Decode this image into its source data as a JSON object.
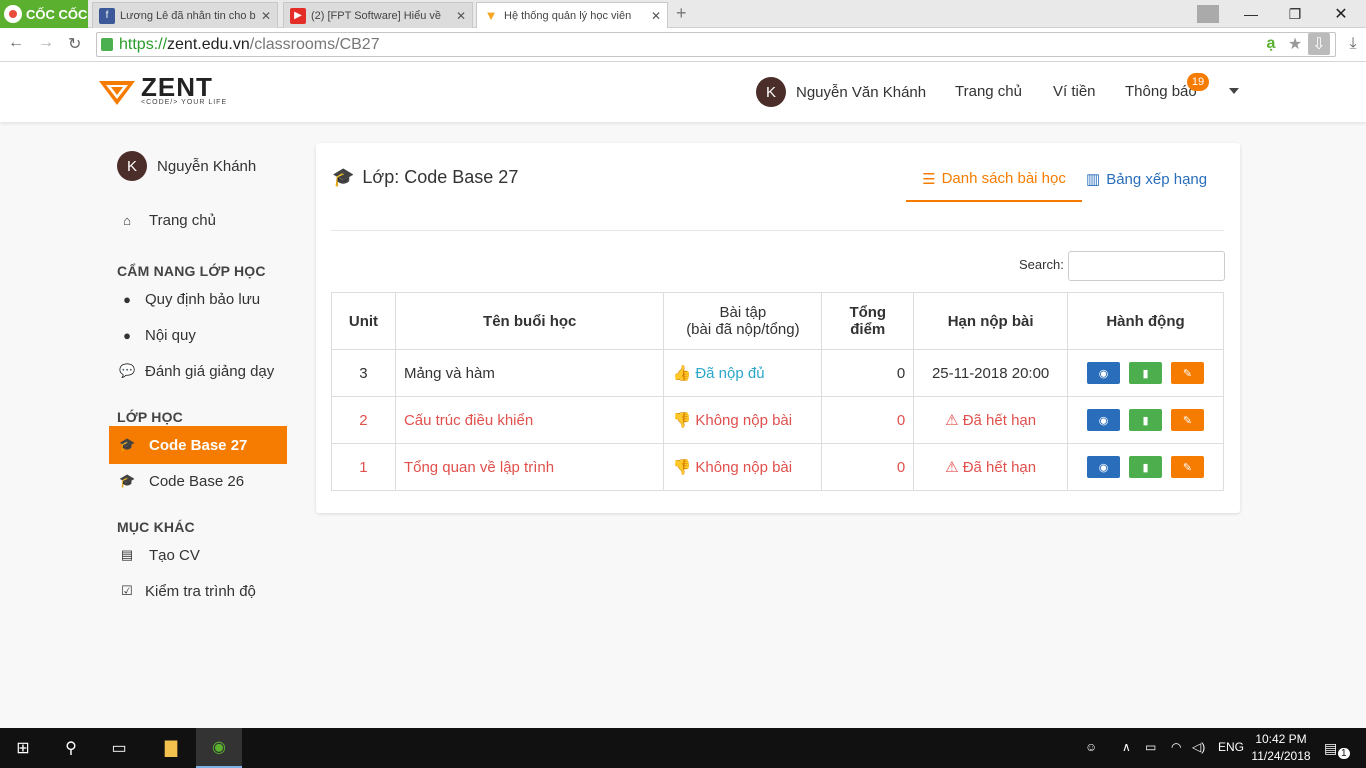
{
  "browser": {
    "brand": "CỐC CỐC",
    "tabs": [
      {
        "title": "Lương Lê đã nhắn tin cho bạn",
        "icon": "facebook-icon"
      },
      {
        "title": "(2) [FPT Software] Hiểu về",
        "icon": "youtube-icon"
      },
      {
        "title": "Hệ thống quản lý học viên",
        "icon": "zent-icon"
      }
    ],
    "url_scheme": "https://",
    "url_host": "zent.edu.vn",
    "url_path": "/classrooms/CB27"
  },
  "navbar": {
    "logo_text": "ZENT",
    "logo_sub": "<CODE/> YOUR LIFE",
    "user_initial": "K",
    "user_name": "Nguyễn Văn Khánh",
    "links": [
      "Trang chủ",
      "Ví tiền",
      "Thông báo"
    ],
    "notification_count": "19"
  },
  "sidebar": {
    "user_initial": "K",
    "user_name": "Nguyễn Khánh",
    "home": "Trang chủ",
    "section_guide": "CẨM NANG LỚP HỌC",
    "guide_items": [
      "Quy định bảo lưu",
      "Nội quy",
      "Đánh giá giảng dạy"
    ],
    "section_class": "LỚP HỌC",
    "class_items": [
      "Code Base 27",
      "Code Base 26"
    ],
    "section_other": "MỤC KHÁC",
    "other_items": [
      "Tạo CV",
      "Kiểm tra trình độ"
    ]
  },
  "main": {
    "title": "Lớp: Code Base 27",
    "tab_lessons": "Danh sách bài học",
    "tab_ranking": "Bảng xếp hạng",
    "search_label": "Search:",
    "headers": [
      "Unit",
      "Tên buổi học",
      "Bài tập",
      "(bài đã nộp/tổng)",
      "Tổng điểm",
      "Hạn nộp bài",
      "Hành động"
    ],
    "rows": [
      {
        "unit": "3",
        "name": "Mảng và hàm",
        "status": "Đã nộp đủ",
        "score": "0",
        "deadline": "25-11-2018 20:00"
      },
      {
        "unit": "2",
        "name": "Cấu trúc điều khiển",
        "status": "Không nộp bài",
        "score": "0",
        "deadline": "Đã hết hạn"
      },
      {
        "unit": "1",
        "name": "Tổng quan về lập trình",
        "status": "Không nộp bài",
        "score": "0",
        "deadline": "Đã hết hạn"
      }
    ]
  },
  "taskbar": {
    "lang": "ENG",
    "time": "10:42 PM",
    "date": "11/24/2018",
    "notif_count": "1"
  }
}
